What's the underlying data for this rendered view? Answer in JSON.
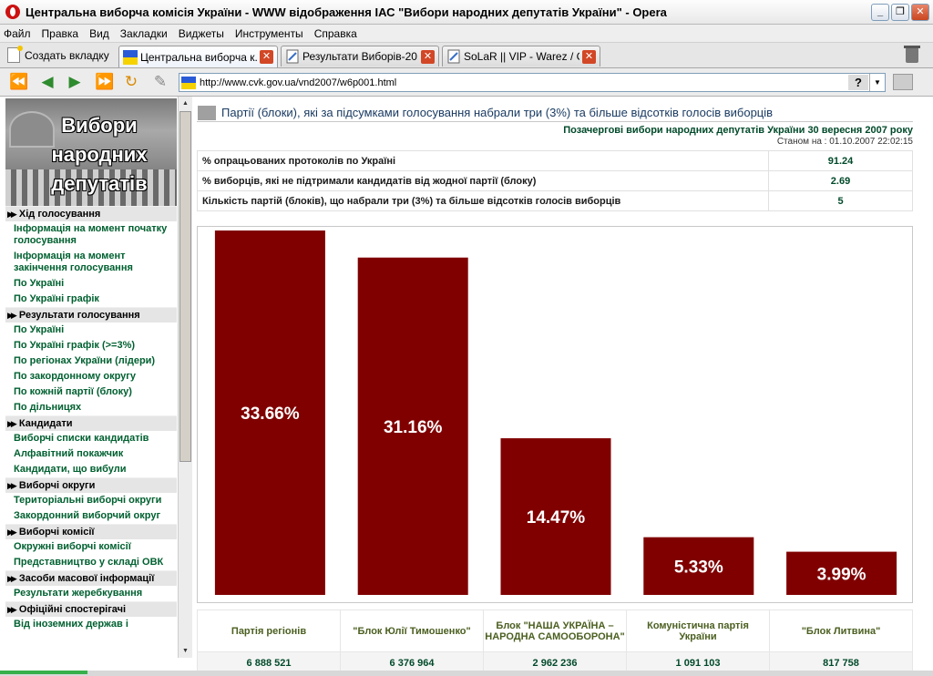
{
  "window": {
    "title": "Центральна виборча комісія України - WWW відображення ІАС \"Вибори народних депутатів України\" - Opera"
  },
  "menu": [
    "Файл",
    "Правка",
    "Вид",
    "Закладки",
    "Виджеты",
    "Инструменты",
    "Справка"
  ],
  "tabs": {
    "new_tab": "Создать вкладку",
    "items": [
      {
        "label": "Центральна виборча к...",
        "active": true
      },
      {
        "label": "Результати Виборів-20...",
        "active": false
      },
      {
        "label": "SoLaR || VIP - Warez / G...",
        "active": false
      }
    ]
  },
  "address": {
    "url": "http://www.cvk.gov.ua/vnd2007/w6p001.html"
  },
  "sidebar": {
    "banner_text": [
      "Вибори",
      "народних",
      "депутатів"
    ],
    "sections": [
      {
        "title": "Хід голосування",
        "links": [
          "Інформація на момент початку голосування",
          "Інформація на момент закінчення голосування",
          "По Україні",
          "По Україні графік"
        ]
      },
      {
        "title": "Результати голосування",
        "links": [
          "По Україні",
          "По Україні графік (>=3%)",
          "По регіонах України (лідери)",
          "По закордонному округу",
          "По кожній партії (блоку)",
          "По дільницях"
        ]
      },
      {
        "title": "Кандидати",
        "links": [
          "Виборчі списки кандидатів",
          "Алфавітний покажчик",
          "Кандидати, що вибули"
        ]
      },
      {
        "title": "Виборчі округи",
        "links": [
          "Територіальні виборчі округи",
          "Закордонний виборчий округ"
        ]
      },
      {
        "title": "Виборчі комісії",
        "links": [
          "Окружні виборчі комісії",
          "Представництво у складі ОВК"
        ]
      },
      {
        "title": "Засоби масової інформації",
        "links": [
          "Результати жеребкування"
        ]
      },
      {
        "title": "Офіційні спостерігачі",
        "links": [
          "Від іноземних держав і"
        ]
      }
    ]
  },
  "page": {
    "title": "Партії (блоки), які за підсумками голосування набрали три (3%) та більше відсотків голосів виборців",
    "election": "Позачергові вибори народних депутатів України 30 вересня 2007 року",
    "as_of": "Станом на : 01.10.2007 22:02:15",
    "stats": [
      {
        "label": "% опрацьованих протоколів по Україні",
        "value": "91.24"
      },
      {
        "label": "% виборців, які не підтримали кандидатів від жодної партії (блоку)",
        "value": "2.69"
      },
      {
        "label": "Кількість партій (блоків), що набрали три (3%) та більше відсотків голосів виборців",
        "value": "5"
      }
    ]
  },
  "chart_data": {
    "type": "bar",
    "categories": [
      "Партія регіонів",
      "\"Блок Юлії Тимошенко\"",
      "Блок \"НАША УКРАЇНА – НАРОДНА САМООБОРОНА\"",
      "Комуністична партія України",
      "\"Блок Литвина\""
    ],
    "values": [
      33.66,
      31.16,
      14.47,
      5.33,
      3.99
    ],
    "value_labels": [
      "33.66%",
      "31.16%",
      "14.47%",
      "5.33%",
      "3.99%"
    ],
    "votes": [
      "6 888 521",
      "6 376 964",
      "2 962 236",
      "1 091 103",
      "817 758"
    ],
    "ylim": [
      0,
      33.66
    ],
    "bar_color": "#800000",
    "label_color": "#ffffff",
    "grid": false,
    "legend": "none"
  },
  "colors": {
    "link": "#006030",
    "title": "#1a3b62",
    "bar": "#800000"
  }
}
